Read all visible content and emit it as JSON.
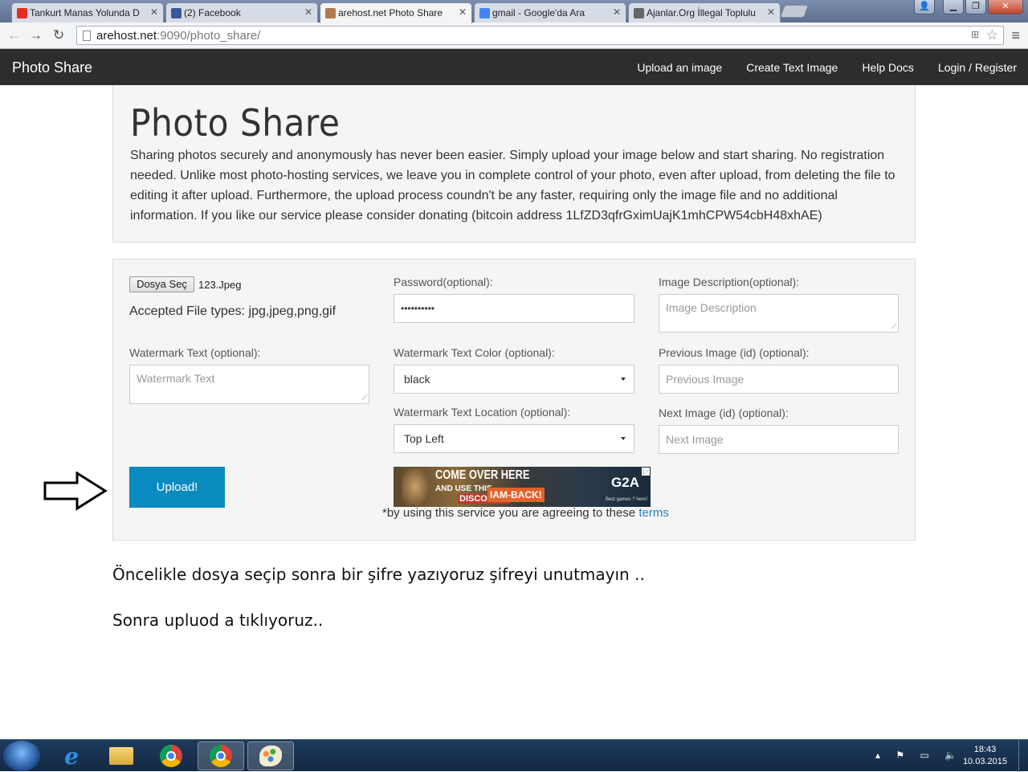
{
  "browser": {
    "tabs": [
      {
        "title": "Tankurt Manas Yolunda D",
        "favicon_color": "#e52d27"
      },
      {
        "title": "(2) Facebook",
        "favicon_color": "#3b5998"
      },
      {
        "title": "arehost.net Photo Share",
        "favicon_color": "#b07a50"
      },
      {
        "title": "gmail - Google'da Ara",
        "favicon_color": "#4285f4"
      },
      {
        "title": "Ajanlar.Org İllegal Toplulu",
        "favicon_color": "#666666"
      }
    ],
    "url_host": "arehost.net",
    "url_rest": ":9090/photo_share/"
  },
  "navbar": {
    "brand": "Photo Share",
    "links": [
      "Upload an image",
      "Create Text Image",
      "Help Docs",
      "Login / Register"
    ]
  },
  "jumbotron": {
    "title": "Photo Share",
    "text": "Sharing photos securely and anonymously has never been easier. Simply upload your image below and start sharing. No registration needed. Unlike most photo-hosting services, we leave you in complete control of your photo, even after upload, from deleting the file to editing it after upload. Furthermore, the upload process coundn't be any faster, requiring only the image file and no additional information. If you like our service please consider donating (bitcoin address 1LfZD3qfrGximUajK1mhCPW54cbH48xhAE)"
  },
  "form": {
    "file_button": "Dosya Seç",
    "file_name": "123.Jpeg",
    "accepted_types": "Accepted File types: jpg,jpeg,png,gif",
    "password_label": "Password(optional):",
    "password_value": "••••••••••",
    "description_label": "Image Description(optional):",
    "description_placeholder": "Image Description",
    "watermark_text_label": "Watermark Text (optional):",
    "watermark_text_placeholder": "Watermark Text",
    "watermark_color_label": "Watermark Text Color (optional):",
    "watermark_color_value": "black",
    "previous_label": "Previous Image (id) (optional):",
    "previous_placeholder": "Previous Image",
    "watermark_location_label": "Watermark Text Location (optional):",
    "watermark_location_value": "Top Left",
    "next_label": "Next Image (id) (optional):",
    "next_placeholder": "Next Image",
    "upload_button": "Upload!",
    "terms_text": "*by using this service you are agreeing to these ",
    "terms_link": "terms"
  },
  "ad": {
    "line1": "COME OVER HERE",
    "line2": "AND USE THIS",
    "line3": "DISCOUNT!",
    "code": "IAM-BACK!",
    "brand": "G2A",
    "tagline": "Best games ? here!"
  },
  "captions": [
    "Öncelikle dosya seçip sonra bir şifre yazıyoruz şifreyi unutmayın ..",
    "Sonra upluod a tıklıyoruz.."
  ],
  "taskbar": {
    "time": "18:43",
    "date": "10.03.2015"
  },
  "colors": {
    "navbar_bg": "#2d2d2d",
    "upload_button": "#0a8bbf",
    "terms_link": "#2a7fb8"
  }
}
